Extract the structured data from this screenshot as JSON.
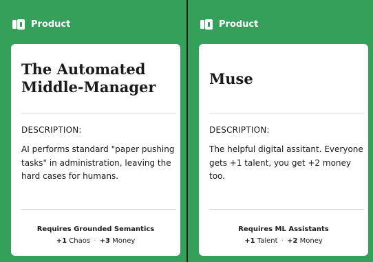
{
  "colors": {
    "panel_background": "#35a05a",
    "card_background": "#ffffff",
    "divider_background": "#1b1b1b"
  },
  "panels": [
    {
      "header": {
        "icon": "product-icon",
        "label": "Product"
      },
      "card": {
        "title": "The Automated Middle-Manager",
        "description_heading": "DESCRIPTION:",
        "description": "AI performs standard \"paper pushing tasks\" in administration, leaving the hard cases for humans.",
        "requires": "Requires Grounded Semantics",
        "effects": [
          {
            "amount": "+1",
            "label": "Chaos"
          },
          {
            "amount": "+3",
            "label": "Money"
          }
        ],
        "separator": "·"
      }
    },
    {
      "header": {
        "icon": "product-icon",
        "label": "Product"
      },
      "card": {
        "title": "Muse",
        "description_heading": "DESCRIPTION:",
        "description": "The helpful digital assitant. Everyone gets +1 talent, you get +2 money too.",
        "requires": "Requires ML Assistants",
        "effects": [
          {
            "amount": "+1",
            "label": "Talent"
          },
          {
            "amount": "+2",
            "label": "Money"
          }
        ],
        "separator": "·"
      }
    }
  ]
}
